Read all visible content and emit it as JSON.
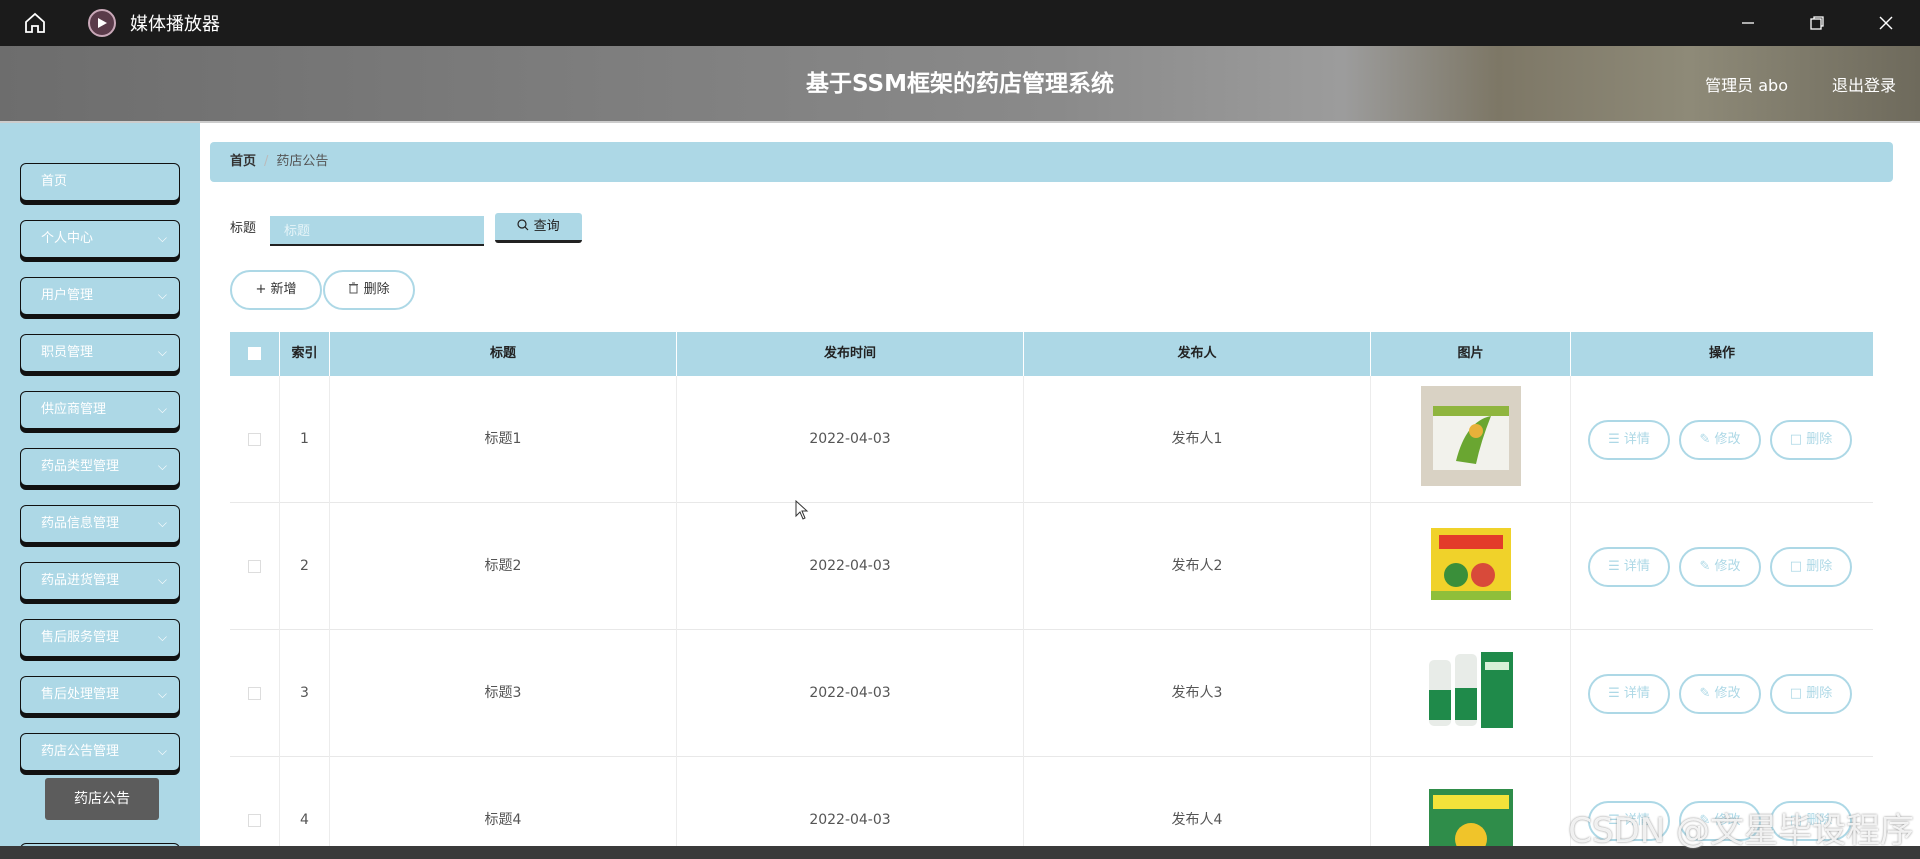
{
  "player": {
    "title": "媒体播放器"
  },
  "header": {
    "title": "基于SSM框架的药店管理系统",
    "user": "管理员 abo",
    "logout": "退出登录"
  },
  "sidebar": {
    "items": [
      {
        "label": "首页"
      },
      {
        "label": "个人中心"
      },
      {
        "label": "用户管理"
      },
      {
        "label": "职员管理"
      },
      {
        "label": "供应商管理"
      },
      {
        "label": "药品类型管理"
      },
      {
        "label": "药品信息管理"
      },
      {
        "label": "药品进货管理"
      },
      {
        "label": "售后服务管理"
      },
      {
        "label": "售后处理管理"
      },
      {
        "label": "药店公告管理"
      }
    ],
    "active_sub": "药店公告"
  },
  "breadcrumb": {
    "home": "首页",
    "sep": "/",
    "current": "药店公告"
  },
  "search": {
    "label": "标题",
    "placeholder": "标题",
    "button": "查询"
  },
  "actions": {
    "add": "新增",
    "delete": "删除"
  },
  "table": {
    "headers": {
      "index": "索引",
      "title": "标题",
      "time": "发布时间",
      "publisher": "发布人",
      "image": "图片",
      "ops": "操作"
    },
    "rows": [
      {
        "index": "1",
        "title": "标题1",
        "time": "2022-04-03",
        "publisher": "发布人1"
      },
      {
        "index": "2",
        "title": "标题2",
        "time": "2022-04-03",
        "publisher": "发布人2"
      },
      {
        "index": "3",
        "title": "标题3",
        "time": "2022-04-03",
        "publisher": "发布人3"
      },
      {
        "index": "4",
        "title": "标题4",
        "time": "2022-04-03",
        "publisher": "发布人4"
      }
    ],
    "row_ops": {
      "detail": "详情",
      "edit": "修改",
      "delete": "删除"
    }
  },
  "watermark": "CSDN @文星毕设程序",
  "colors": {
    "accent": "#add8e6",
    "titlebar": "#1b1b1b"
  }
}
